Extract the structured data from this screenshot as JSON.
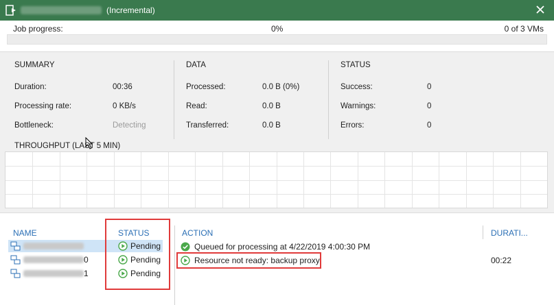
{
  "window": {
    "title": "(Incremental)",
    "close_icon": "close-icon",
    "app_icon": "backup-job-icon"
  },
  "progress": {
    "label": "Job progress:",
    "percent_text": "0%",
    "value": 0,
    "vms_text": "0 of 3 VMs"
  },
  "summary": {
    "title": "SUMMARY",
    "duration_label": "Duration:",
    "duration_value": "00:36",
    "rate_label": "Processing rate:",
    "rate_value": "0 KB/s",
    "bottleneck_label": "Bottleneck:",
    "bottleneck_value": "Detecting"
  },
  "data_section": {
    "title": "DATA",
    "processed_label": "Processed:",
    "processed_value": "0.0 B (0%)",
    "read_label": "Read:",
    "read_value": "0.0 B",
    "transferred_label": "Transferred:",
    "transferred_value": "0.0 B"
  },
  "status_section": {
    "title": "STATUS",
    "success_label": "Success:",
    "success_value": "0",
    "warnings_label": "Warnings:",
    "warnings_value": "0",
    "errors_label": "Errors:",
    "errors_value": "0"
  },
  "throughput": {
    "title": "THROUGHPUT (LAST 5 MIN)"
  },
  "list": {
    "headers": {
      "name": "NAME",
      "status": "STATUS",
      "action": "ACTION",
      "duration": "DURATI..."
    },
    "vms": [
      {
        "suffix": "",
        "status": "Pending"
      },
      {
        "suffix": "0",
        "status": "Pending"
      },
      {
        "suffix": "1",
        "status": "Pending"
      }
    ],
    "actions": [
      {
        "text": "Queued for processing at 4/22/2019 4:00:30 PM",
        "icon": "success-check-icon",
        "duration": ""
      },
      {
        "text": "Resource not ready: backup proxy",
        "icon": "pending-play-icon",
        "duration": "00:22"
      }
    ]
  },
  "colors": {
    "titlebar": "#3a7a4e",
    "header_blue": "#2b6fb5",
    "highlight_red": "#e03a3a",
    "pending_green": "#4aa84a"
  }
}
